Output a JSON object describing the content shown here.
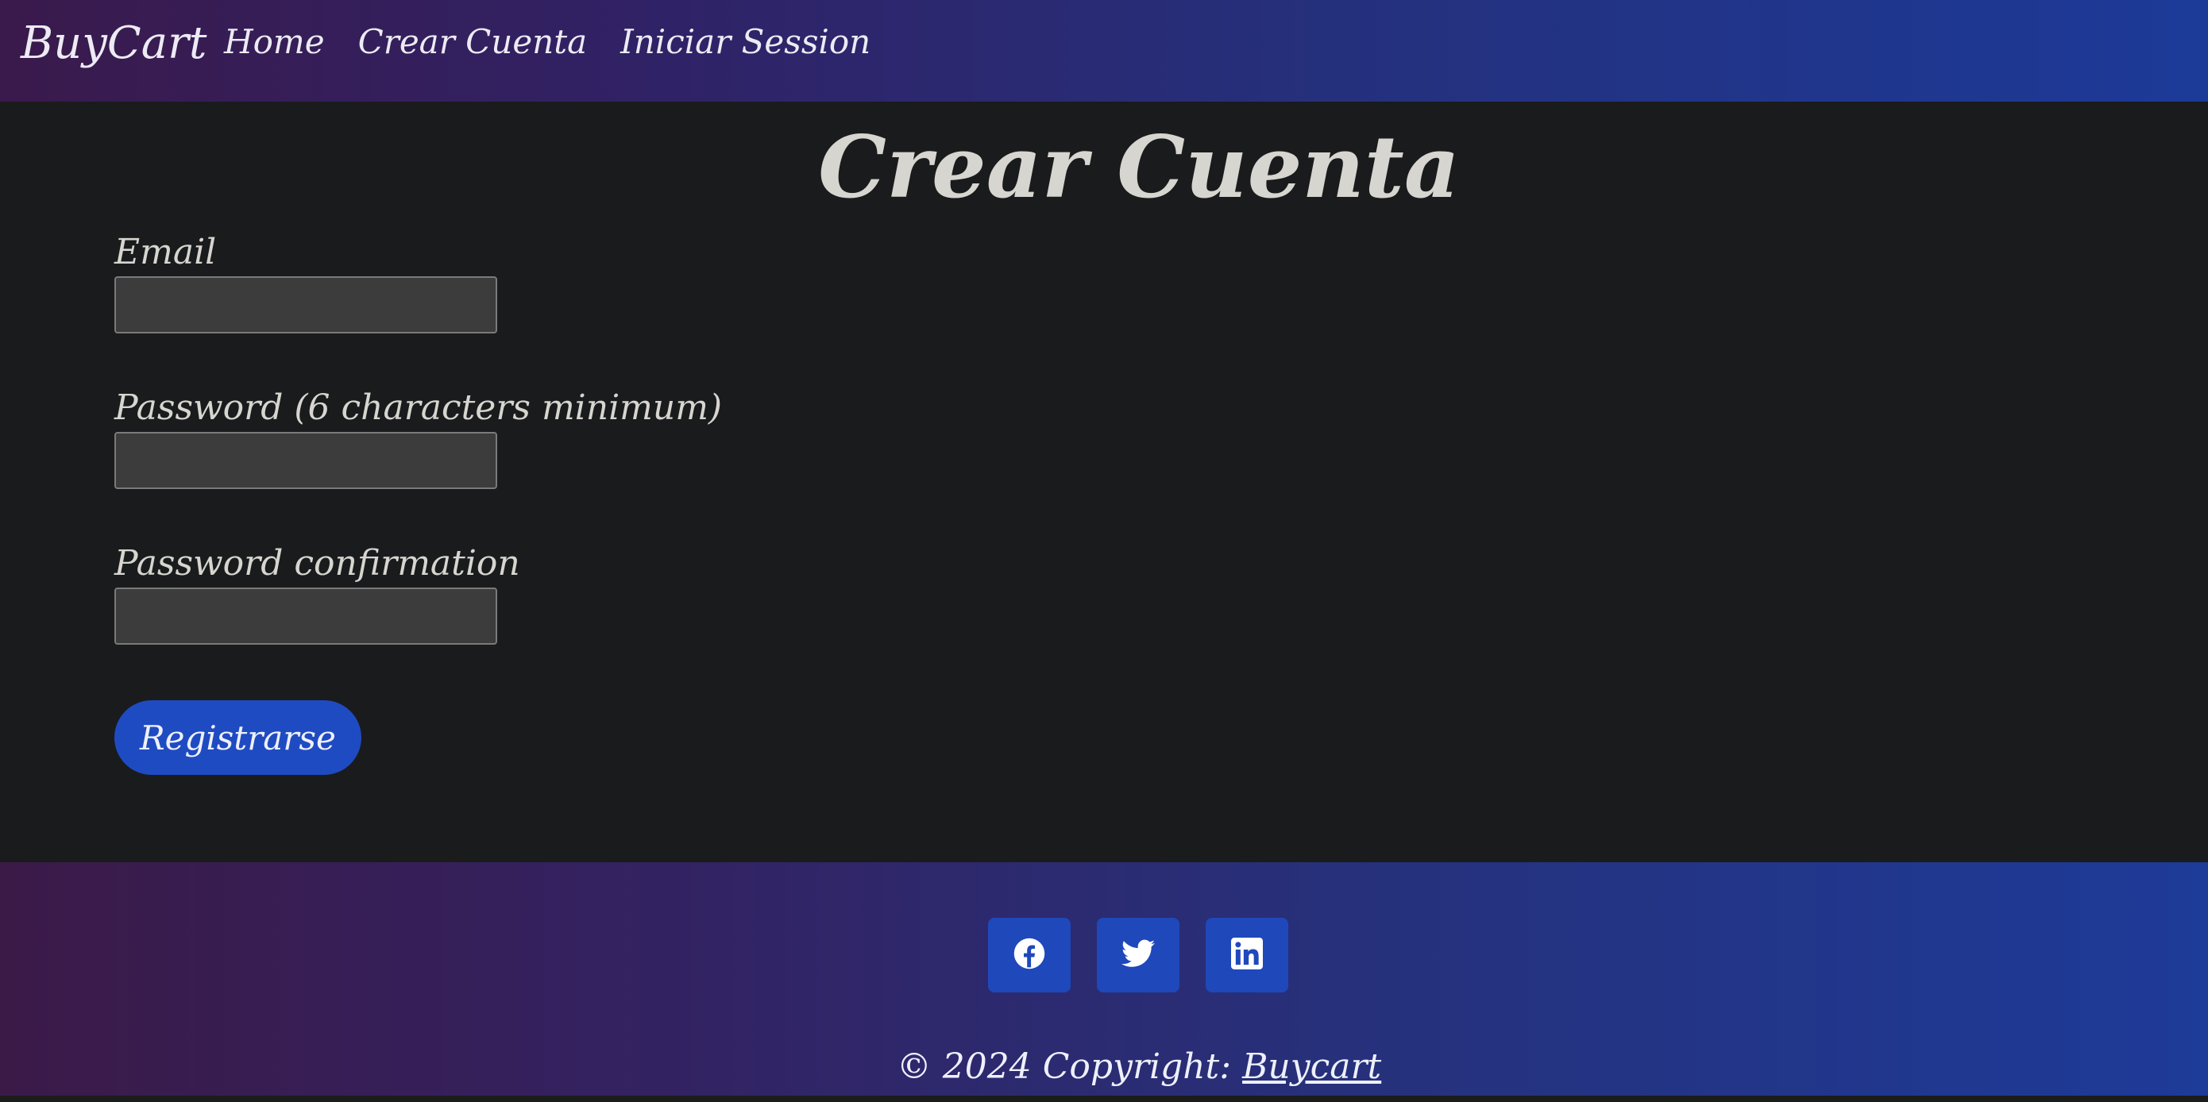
{
  "navbar": {
    "brand": "BuyCart",
    "links": [
      {
        "label": "Home"
      },
      {
        "label": "Crear Cuenta"
      },
      {
        "label": "Iniciar Session"
      }
    ]
  },
  "page": {
    "title": "Crear Cuenta"
  },
  "form": {
    "fields": [
      {
        "label": "Email",
        "value": "",
        "placeholder": ""
      },
      {
        "label": "Password (6 characters minimum)",
        "value": "",
        "placeholder": ""
      },
      {
        "label": "Password confirmation",
        "value": "",
        "placeholder": ""
      }
    ],
    "submit_label": "Registrarse"
  },
  "footer": {
    "social": [
      {
        "icon": "facebook-icon"
      },
      {
        "icon": "twitter-icon"
      },
      {
        "icon": "linkedin-icon"
      }
    ],
    "copyright_prefix": "© 2024 Copyright:",
    "copyright_link": "Buycart"
  },
  "colors": {
    "accent": "#1f4bc2",
    "background": "#1a1b1d",
    "input_bg": "#3c3c3c"
  }
}
